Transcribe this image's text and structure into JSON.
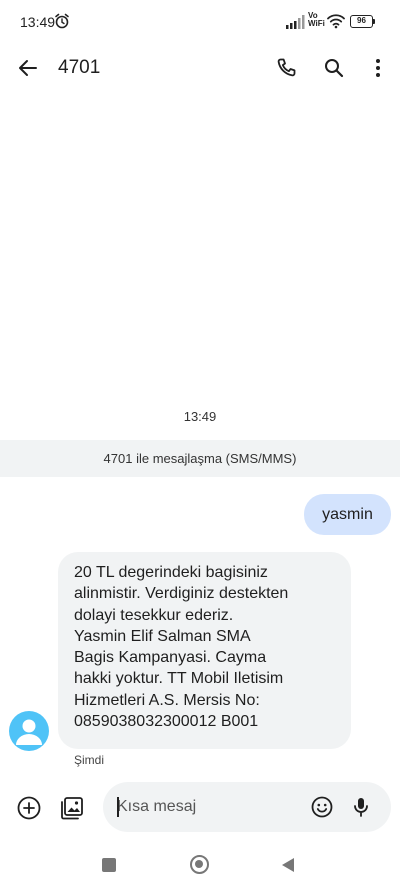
{
  "status_bar": {
    "time": "13:49",
    "vo_label": "Vo",
    "wifi_label": "WiFi",
    "battery_level": "96",
    "icons": [
      "alarm-icon",
      "signal-icon",
      "wifi-icon",
      "battery-icon"
    ]
  },
  "app_bar": {
    "title": "4701",
    "icons": [
      "back-arrow-icon",
      "phone-icon",
      "search-icon",
      "more-vert-icon"
    ]
  },
  "conversation": {
    "timestamp": "13:49",
    "banner": "4701 ile mesajlaşma (SMS/MMS)",
    "outgoing_message": "yasmin",
    "incoming_message": "20 TL degerindeki bagisiniz\nalinmistir. Verdiginiz destekten\ndolayi tesekkur ederiz.\nYasmin Elif Salman SMA\nBagis Kampanyasi. Cayma\nhakki yoktur. TT Mobil Iletisim\nHizmetleri A.S. Mersis No:\n0859038032300012 B001",
    "incoming_status": "Şimdi"
  },
  "compose": {
    "placeholder": "Kısa mesaj",
    "value": "",
    "icons": [
      "add-circle-icon",
      "gallery-icon",
      "emoji-icon",
      "mic-icon"
    ]
  },
  "nav_bar": {
    "icons": [
      "recents-icon",
      "home-icon",
      "back-triangle-icon"
    ]
  },
  "colors": {
    "outgoing_bubble": "#d3e3fd",
    "incoming_bubble": "#f1f3f4",
    "avatar": "#4fc3f7",
    "banner": "#f1f3f4"
  }
}
